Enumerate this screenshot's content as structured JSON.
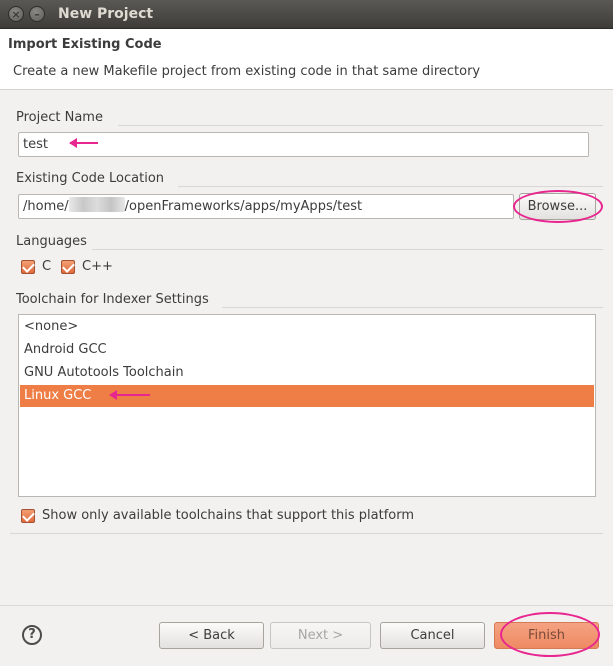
{
  "window": {
    "title": "New Project",
    "close_glyph": "×",
    "minimize_glyph": "–"
  },
  "header": {
    "title": "Import Existing Code",
    "description": "Create a new Makefile project from existing code in that same directory"
  },
  "project_name": {
    "label": "Project Name",
    "value": "test"
  },
  "code_location": {
    "label": "Existing Code Location",
    "value_prefix": "/home/",
    "value_suffix": "/openFrameworks/apps/myApps/test",
    "browse_label": "Browse..."
  },
  "languages": {
    "label": "Languages",
    "items": [
      {
        "label": "C",
        "checked": true
      },
      {
        "label": "C++",
        "checked": true
      }
    ]
  },
  "toolchain": {
    "label": "Toolchain for Indexer Settings",
    "items": [
      "<none>",
      "Android GCC",
      "GNU Autotools Toolchain",
      "Linux GCC"
    ],
    "selected": "Linux GCC",
    "filter_label": "Show only available toolchains that support this platform"
  },
  "footer": {
    "help_glyph": "?",
    "back_label": "< Back",
    "next_label": "Next >",
    "cancel_label": "Cancel",
    "finish_label": "Finish"
  },
  "colors": {
    "accent": "#ef7d46",
    "annotation": "#e8268f"
  },
  "icons": {
    "help": "question-circle-icon",
    "checkbox": "checkmark-icon"
  }
}
